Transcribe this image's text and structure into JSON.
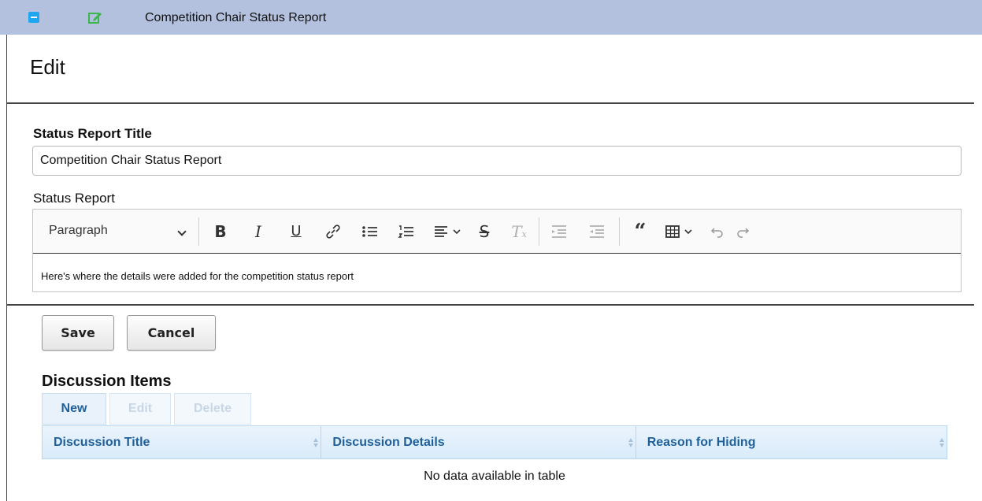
{
  "window": {
    "title": "Competition Chair Status Report",
    "colors": {
      "titlebar": "#b3c1de",
      "minimize": "#1ea7f0",
      "edit_icon": "#3cb54a"
    }
  },
  "page": {
    "heading": "Edit"
  },
  "form": {
    "title_label": "Status Report Title",
    "title_value": "Competition Chair Status Report",
    "report_label": "Status Report",
    "editor": {
      "block_format": "Paragraph",
      "toolbar_icons": [
        "bold-icon",
        "italic-icon",
        "underline-icon",
        "link-icon",
        "bulleted-list-icon",
        "numbered-list-icon",
        "align-icon",
        "strikethrough-icon",
        "remove-format-icon",
        "outdent-icon",
        "indent-icon",
        "blockquote-icon",
        "table-icon",
        "undo-icon",
        "redo-icon"
      ],
      "content": "Here's where the details were added for the competition status report"
    }
  },
  "actions": {
    "save": "Save",
    "cancel": "Cancel"
  },
  "discussion": {
    "heading": "Discussion Items",
    "buttons": {
      "new": "New",
      "edit": "Edit",
      "delete": "Delete"
    },
    "columns": [
      "Discussion Title",
      "Discussion Details",
      "Reason for Hiding"
    ],
    "empty_message": "No data available in table",
    "colors": {
      "header_text": "#1f5f9a",
      "header_bg": "#dcecfa"
    }
  }
}
